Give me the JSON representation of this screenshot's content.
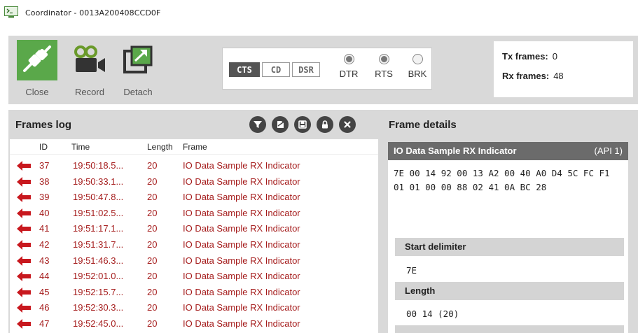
{
  "window": {
    "title": "Coordinator - 0013A200408CCD0F",
    "icon": "terminal-icon"
  },
  "toolbar": {
    "buttons": [
      {
        "label": "Close",
        "icon": "plug-disconnect-icon",
        "accent": "#5aa84a"
      },
      {
        "label": "Record",
        "icon": "video-camera-icon"
      },
      {
        "label": "Detach",
        "icon": "detach-window-icon"
      }
    ],
    "signals": {
      "cts": "CTS",
      "cd": "CD",
      "dsr": "DSR"
    },
    "lines": [
      {
        "label": "DTR",
        "on": true
      },
      {
        "label": "RTS",
        "on": true
      },
      {
        "label": "BRK",
        "on": false
      }
    ],
    "tx_label": "Tx frames:",
    "tx_value": "0",
    "rx_label": "Rx frames:",
    "rx_value": "48"
  },
  "frames_log": {
    "title": "Frames log",
    "actions": [
      "filter-icon",
      "clear-icon",
      "save-icon",
      "lock-icon",
      "close-icon"
    ],
    "columns": {
      "id": "ID",
      "time": "Time",
      "length": "Length",
      "frame": "Frame"
    },
    "rows": [
      {
        "id": "37",
        "time": "19:50:18.5...",
        "length": "20",
        "frame": "IO Data Sample RX Indicator"
      },
      {
        "id": "38",
        "time": "19:50:33.1...",
        "length": "20",
        "frame": "IO Data Sample RX Indicator"
      },
      {
        "id": "39",
        "time": "19:50:47.8...",
        "length": "20",
        "frame": "IO Data Sample RX Indicator"
      },
      {
        "id": "40",
        "time": "19:51:02.5...",
        "length": "20",
        "frame": "IO Data Sample RX Indicator"
      },
      {
        "id": "41",
        "time": "19:51:17.1...",
        "length": "20",
        "frame": "IO Data Sample RX Indicator"
      },
      {
        "id": "42",
        "time": "19:51:31.7...",
        "length": "20",
        "frame": "IO Data Sample RX Indicator"
      },
      {
        "id": "43",
        "time": "19:51:46.3...",
        "length": "20",
        "frame": "IO Data Sample RX Indicator"
      },
      {
        "id": "44",
        "time": "19:52:01.0...",
        "length": "20",
        "frame": "IO Data Sample RX Indicator"
      },
      {
        "id": "45",
        "time": "19:52:15.7...",
        "length": "20",
        "frame": "IO Data Sample RX Indicator"
      },
      {
        "id": "46",
        "time": "19:52:30.3...",
        "length": "20",
        "frame": "IO Data Sample RX Indicator"
      },
      {
        "id": "47",
        "time": "19:52:45.0...",
        "length": "20",
        "frame": "IO Data Sample RX Indicator"
      }
    ],
    "row_color": "#a51c1c"
  },
  "frame_details": {
    "title": "Frame details",
    "frame_name": "IO Data Sample RX Indicator",
    "api": "(API 1)",
    "hex": "7E 00 14 92 00 13 A2 00 40 A0 D4 5C FC F1 01 01 00 00 88 02 41 0A BC 28",
    "fields": [
      {
        "label": "Start delimiter",
        "value": "7E"
      },
      {
        "label": "Length",
        "value": "00 14 (20)"
      }
    ]
  }
}
